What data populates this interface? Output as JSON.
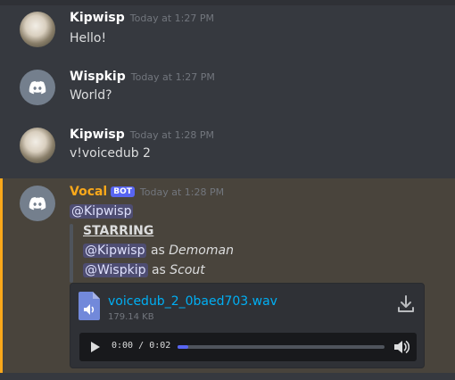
{
  "messages": [
    {
      "author": "Kipwisp",
      "time": "Today at 1:27 PM",
      "text": "Hello!"
    },
    {
      "author": "Wispkip",
      "time": "Today at 1:27 PM",
      "text": "World?"
    },
    {
      "author": "Kipwisp",
      "time": "Today at 1:28 PM",
      "text": "v!voicedub 2"
    }
  ],
  "bot_message": {
    "author": "Vocal",
    "author_color": "#faa81a",
    "tag": "BOT",
    "time": "Today at 1:28 PM",
    "mention": "@Kipwisp",
    "quote": {
      "heading": "STARRING",
      "cast": [
        {
          "mention": "@Kipwisp",
          "as_text": "as",
          "role": "Demoman"
        },
        {
          "mention": "@Wispkip",
          "as_text": "as",
          "role": "Scout"
        }
      ]
    },
    "attachment": {
      "file_name": "voicedub_2_0baed703.wav",
      "file_size": "179.14 KB",
      "current_time": "0:00",
      "separator": "/",
      "duration": "0:02",
      "progress": 0.05
    }
  },
  "icons": {
    "discord_avatar": "discord-logo-icon",
    "file": "audio-file-icon",
    "download": "download-icon",
    "play": "play-icon",
    "volume": "volume-icon"
  }
}
